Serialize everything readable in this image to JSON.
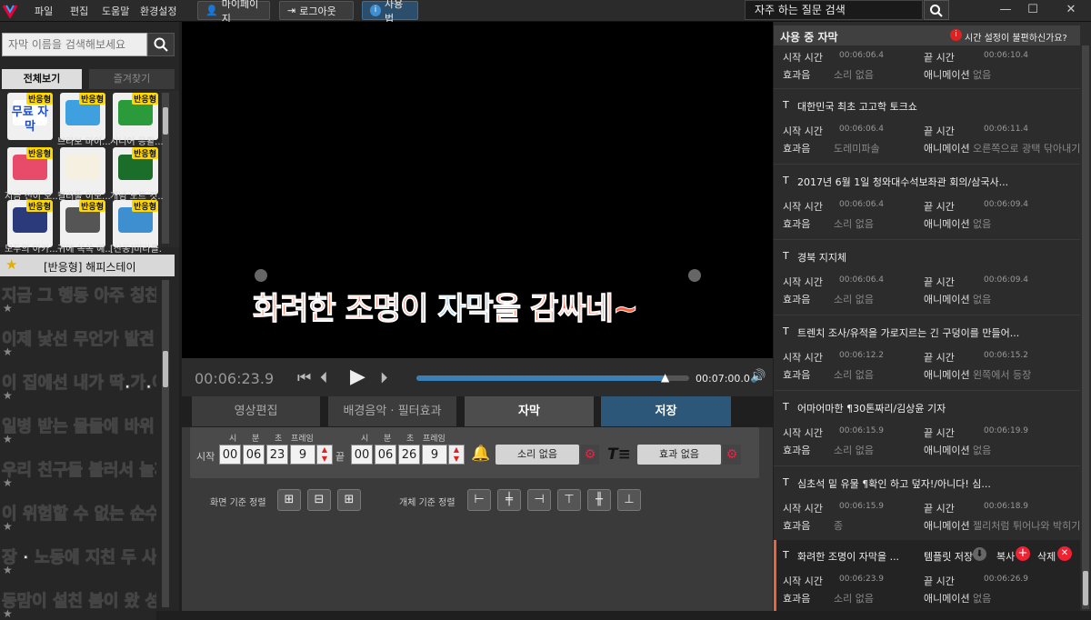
{
  "menu": {
    "items": [
      "파일",
      "편집",
      "도움말",
      "환경설정"
    ]
  },
  "top_buttons": {
    "mypage": "마이페이지",
    "logout": "로그아웃",
    "howto": "사용법"
  },
  "faq_search": {
    "label": "자주 하는 질문 검색"
  },
  "left": {
    "search_placeholder": "자막 이름을 검색해보세요",
    "tabs": [
      "전체보기",
      "즐겨찾기"
    ],
    "thumbs": [
      {
        "label": "",
        "badge": "반응형",
        "color": "#ffffff"
      },
      {
        "label": "브라보 마이...",
        "badge": "반응형",
        "color": "#3fa0e0"
      },
      {
        "label": "시니어 응활...",
        "badge": "반응형",
        "color": "#2b9a3a"
      },
      {
        "label": "지금 신이 오...",
        "badge": "반응형",
        "color": "#e84a6a"
      },
      {
        "label": "컬러풀 이모...",
        "badge": "",
        "color": "#f5f0e0"
      },
      {
        "label": "개념 노트 컷...",
        "badge": "반응형",
        "color": "#1b6e2a"
      },
      {
        "label": "모두의 아카...",
        "badge": "반응형",
        "color": "#2a3a7a"
      },
      {
        "label": "귀에 쏙쏙 예...",
        "badge": "반응형",
        "color": "#555555"
      },
      {
        "label": "[산동]미라클...",
        "badge": "반응형",
        "color": "#3e8fd0"
      }
    ],
    "first_thumb_text": "무료 자막",
    "preset_header": "[반응형] 해피스테이",
    "presets": [
      {
        "text": "지금 그 행동 아주 칭찬해",
        "color": "#ffffff"
      },
      {
        "text": "이제 낯선 무언가 발견!",
        "color": "#ffffff"
      },
      {
        "text": "이 집에선 내가 딱.가.이.버",
        "color": "#ffffff"
      },
      {
        "text": "일병 받는 물들에 바위 뚫 나왔어!",
        "color": "#ffffff"
      },
      {
        "text": "우리 친구들 불러서 놀까?",
        "color": "#ffffff"
      },
      {
        "text": "이 위험할 수 없는 순수함",
        "color": "#ffffff"
      },
      {
        "text": "장 · 노동에 지친 두 사람",
        "color": "#ffffff"
      },
      {
        "text": "동맘이 설친 봄이 왔 성",
        "color": "#ffffff"
      }
    ]
  },
  "video": {
    "caption": [
      "화려한 조명이 ",
      "자막",
      "을 감싸네~"
    ],
    "current_time": "00:06:23.9",
    "end_time": "00:07:00.0",
    "progress": 0.91
  },
  "main_tabs": [
    "영상편집",
    "배경음악 · 필터효과",
    "자막",
    "저장"
  ],
  "timing": {
    "unit_labels": [
      "시",
      "분",
      "초",
      "프레임"
    ],
    "start_label": "시작",
    "end_label": "끝",
    "start": [
      "00",
      "06",
      "23",
      "9"
    ],
    "end": [
      "00",
      "06",
      "26",
      "9"
    ],
    "sound": "소리 없음",
    "effect": "효과 없음"
  },
  "align": {
    "screen_label": "화면 기준 정렬",
    "object_label": "개체 기준 정렬"
  },
  "right": {
    "header": "사용 중 자막",
    "help": "시간 설정이 불편하신가요?",
    "labels": {
      "start": "시작 시간",
      "end": "끝 시간",
      "sound": "효과음",
      "anim": "애니메이션"
    },
    "first": {
      "start": "00:06:06.4",
      "end": "00:06:10.4",
      "sound": "소리 없음",
      "anim": "없음"
    },
    "entries": [
      {
        "title": "대한민국 최초 고고학 토크쇼",
        "start": "00:06:06.4",
        "end": "00:06:11.4",
        "sound": "도레미파솔",
        "anim": "오른쪽으로 광택 닦아내기"
      },
      {
        "title": "2017년 6월 1일 청와대수석보좌관 회의/삼국사...",
        "start": "00:06:06.4",
        "end": "00:06:09.4",
        "sound": "소리 없음",
        "anim": "없음"
      },
      {
        "title": "경북 지지체",
        "start": "00:06:06.4",
        "end": "00:06:09.4",
        "sound": "소리 없음",
        "anim": "없음"
      },
      {
        "title": "트렌치 조사/유적을 가로지르는 긴 구덩이를 만들어...",
        "start": "00:06:12.2",
        "end": "00:06:15.2",
        "sound": "소리 없음",
        "anim": "왼쪽에서 등장"
      },
      {
        "title": "어마어마한 ¶30톤짜리/김상윤 기자",
        "start": "00:06:15.9",
        "end": "00:06:19.9",
        "sound": "소리 없음",
        "anim": "없음"
      },
      {
        "title": "심초석 밑  유물 ¶확인 하고 덮자!/아니다! 심...",
        "start": "00:06:15.9",
        "end": "00:06:18.9",
        "sound": "종",
        "anim": "젤리처럼 튀어나와 박히기"
      }
    ],
    "active": {
      "title": "화려한 조명이 자막을 ...",
      "start": "00:06:23.9",
      "end": "00:06:26.9",
      "sound": "소리 없음",
      "anim": "없음",
      "save_template": "템플릿 저장",
      "copy": "복사",
      "delete": "삭제"
    }
  }
}
